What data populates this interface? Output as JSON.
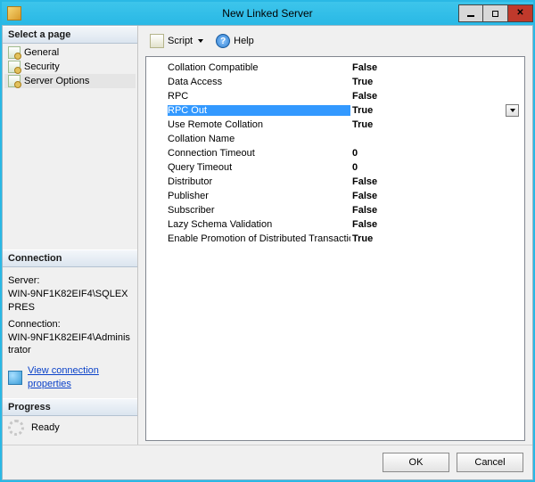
{
  "window": {
    "title": "New Linked Server"
  },
  "pages": {
    "header": "Select a page",
    "items": [
      {
        "label": "General"
      },
      {
        "label": "Security"
      },
      {
        "label": "Server Options"
      }
    ],
    "selected_index": 2
  },
  "toolbar": {
    "script_label": "Script",
    "help_label": "Help"
  },
  "properties": [
    {
      "name": "Collation Compatible",
      "value": "False"
    },
    {
      "name": "Data Access",
      "value": "True"
    },
    {
      "name": "RPC",
      "value": "False"
    },
    {
      "name": "RPC Out",
      "value": "True"
    },
    {
      "name": "Use Remote Collation",
      "value": "True"
    },
    {
      "name": "Collation Name",
      "value": ""
    },
    {
      "name": "Connection Timeout",
      "value": "0"
    },
    {
      "name": "Query Timeout",
      "value": "0"
    },
    {
      "name": "Distributor",
      "value": "False"
    },
    {
      "name": "Publisher",
      "value": "False"
    },
    {
      "name": "Subscriber",
      "value": "False"
    },
    {
      "name": "Lazy Schema Validation",
      "value": "False"
    },
    {
      "name": "Enable Promotion of Distributed Transaction",
      "value": "True"
    }
  ],
  "selected_property_index": 3,
  "connection": {
    "header": "Connection",
    "server_label": "Server:",
    "server_value": "WIN-9NF1K82EIF4\\SQLEXPRES",
    "conn_label": "Connection:",
    "conn_value": "WIN-9NF1K82EIF4\\Administrator",
    "link_label": "View connection properties"
  },
  "progress": {
    "header": "Progress",
    "status": "Ready"
  },
  "buttons": {
    "ok": "OK",
    "cancel": "Cancel"
  }
}
